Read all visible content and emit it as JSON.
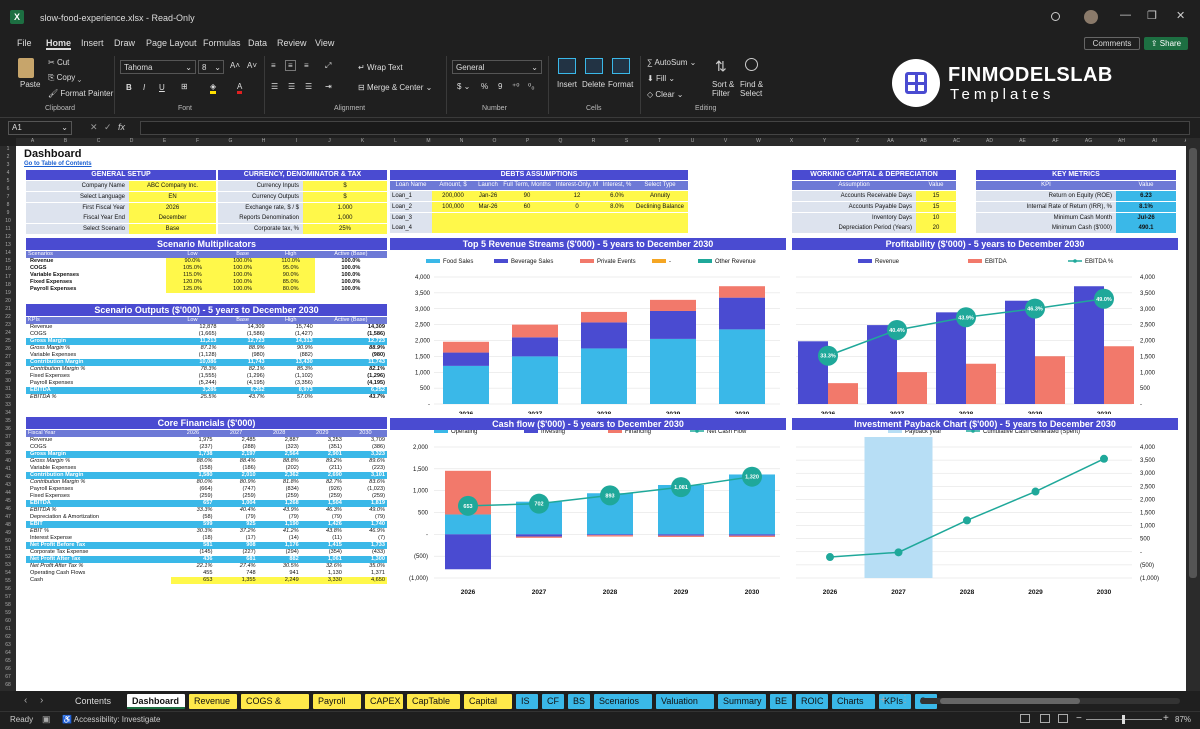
{
  "titlebar": {
    "filename": "slow-food-experience.xlsx",
    "mode": "Read-Only"
  },
  "menu": [
    "File",
    "Home",
    "Insert",
    "Draw",
    "Page Layout",
    "Formulas",
    "Data",
    "Review",
    "View"
  ],
  "menu_active": "Home",
  "comments_label": "Comments",
  "share_label": "Share",
  "ribbon": {
    "paste": "Paste",
    "cut": "Cut",
    "copy": "Copy",
    "format_painter": "Format Painter",
    "clipboard": "Clipboard",
    "font_name": "Tahoma",
    "font_size": "8",
    "font": "Font",
    "wrap": "Wrap Text",
    "merge": "Merge & Center",
    "alignment": "Alignment",
    "numfmt": "General",
    "number": "Number",
    "insert": "Insert",
    "delete": "Delete",
    "format": "Format",
    "cells": "Cells",
    "autosum": "AutoSum",
    "fill": "Fill",
    "clear": "Clear",
    "sort": "Sort & Filter",
    "find": "Find & Select",
    "editing": "Editing",
    "brand1": "FINMODELSLAB",
    "brand2": "Templates"
  },
  "namebox": "A1",
  "fx": "fx",
  "sheet": {
    "title": "Dashboard",
    "toc": "Go to Table of Contents"
  },
  "general": {
    "title": "GENERAL SETUP",
    "rows": [
      [
        "Company Name",
        "ABC Company Inc."
      ],
      [
        "Select Language",
        "EN"
      ],
      [
        "First Fiscal Year",
        "2026"
      ],
      [
        "Fiscal Year End",
        "December"
      ],
      [
        "Select Scenario",
        "Base"
      ]
    ]
  },
  "currency": {
    "title": "CURRENCY, DENOMINATOR & TAX",
    "rows": [
      [
        "Currency Inputs",
        "$"
      ],
      [
        "Currency Outputs",
        "$"
      ],
      [
        "Exchange rate, $ / $",
        "1.000"
      ],
      [
        "Reports Denomination",
        "1,000"
      ],
      [
        "Corporate tax, %",
        "25%"
      ]
    ]
  },
  "debts": {
    "title": "DEBTS ASSUMPTIONS",
    "cols": [
      "Loan Name",
      "Amount, $",
      "Launch",
      "Full Term, Months",
      "Interest-Only, M",
      "Interest, %",
      "Select Type"
    ],
    "rows": [
      [
        "Loan_1",
        "200,000",
        "Jan-26",
        "90",
        "12",
        "6.0%",
        "Annuity"
      ],
      [
        "Loan_2",
        "100,000",
        "Mar-26",
        "60",
        "0",
        "8.0%",
        "Declining Balance"
      ],
      [
        "Loan_3",
        "",
        "",
        "",
        "",
        "",
        ""
      ],
      [
        "Loan_4",
        "",
        "",
        "",
        "",
        "",
        ""
      ]
    ]
  },
  "wc": {
    "title": "WORKING CAPITAL & DEPRECIATION",
    "cols": [
      "Assumption",
      "Value"
    ],
    "rows": [
      [
        "Accounts Receivable Days",
        "15"
      ],
      [
        "Accounts Payable Days",
        "15"
      ],
      [
        "Inventory Days",
        "10"
      ],
      [
        "Depreciation Period (Years)",
        "20"
      ]
    ]
  },
  "kpi": {
    "title": "KEY METRICS",
    "cols": [
      "KPI",
      "Value"
    ],
    "rows": [
      [
        "Return on Equity (ROE)",
        "6.23"
      ],
      [
        "Internal Rate of Return (IRR), %",
        "8.1%"
      ],
      [
        "Minimum Cash Month",
        "Jul-26"
      ],
      [
        "Minimum Cash ($'000)",
        "490.1"
      ]
    ]
  },
  "scenmult": {
    "title": "Scenario Multiplicators",
    "cols": [
      "Scenarios",
      "Low",
      "Base",
      "High",
      "Active (Base)"
    ],
    "rows": [
      [
        "Revenue",
        "90.0%",
        "100.0%",
        "110.0%",
        "100.0%"
      ],
      [
        "COGS",
        "105.0%",
        "100.0%",
        "95.0%",
        "100.0%"
      ],
      [
        "Variable Expenses",
        "115.0%",
        "100.0%",
        "90.0%",
        "100.0%"
      ],
      [
        "Fixed Expenses",
        "120.0%",
        "100.0%",
        "85.0%",
        "100.0%"
      ],
      [
        "Payroll Expenses",
        "125.0%",
        "100.0%",
        "80.0%",
        "100.0%"
      ]
    ]
  },
  "scenout": {
    "title": "Scenario Outputs ($'000) - 5 years to December 2030",
    "cols": [
      "KPIs",
      "Low",
      "Base",
      "High",
      "Active (Base)"
    ],
    "rows": [
      [
        "Revenue",
        "12,878",
        "14,309",
        "15,740",
        "14,309",
        ""
      ],
      [
        "COGS",
        "(1,665)",
        "(1,586)",
        "(1,427)",
        "(1,586)",
        ""
      ],
      [
        "Gross Margin",
        "11,213",
        "12,723",
        "14,313",
        "12,723",
        "hl"
      ],
      [
        "Gross Margin %",
        "87.1%",
        "88.9%",
        "90.9%",
        "88.9%",
        "it"
      ],
      [
        "Variable Expenses",
        "(1,128)",
        "(980)",
        "(882)",
        "(980)",
        ""
      ],
      [
        "Contribution Margin",
        "10,086",
        "11,743",
        "13,430",
        "11,743",
        "hl"
      ],
      [
        "Contribution Margin %",
        "78.3%",
        "82.1%",
        "85.3%",
        "82.1%",
        "it"
      ],
      [
        "Fixed Expenses",
        "(1,555)",
        "(1,296)",
        "(1,102)",
        "(1,296)",
        ""
      ],
      [
        "Payroll Expenses",
        "(5,244)",
        "(4,195)",
        "(3,356)",
        "(4,195)",
        ""
      ],
      [
        "EBITDA",
        "3,286",
        "6,252",
        "8,973",
        "6,252",
        "hl"
      ],
      [
        "EBITDA %",
        "25.5%",
        "43.7%",
        "57.0%",
        "43.7%",
        "it"
      ]
    ]
  },
  "corefin": {
    "title": "Core Financials ($'000)",
    "cols": [
      "Fiscal Year",
      "2026",
      "2027",
      "2028",
      "2029",
      "2030"
    ],
    "rows": [
      [
        "Revenue",
        "1,975",
        "2,485",
        "2,887",
        "3,253",
        "3,709",
        ""
      ],
      [
        "COGS",
        "(237)",
        "(288)",
        "(323)",
        "(351)",
        "(386)",
        ""
      ],
      [
        "Gross Margin",
        "1,738",
        "2,197",
        "2,564",
        "2,901",
        "3,323",
        "hl"
      ],
      [
        "Gross Margin %",
        "88.0%",
        "88.4%",
        "88.8%",
        "89.2%",
        "89.6%",
        "it"
      ],
      [
        "Variable Expenses",
        "(158)",
        "(186)",
        "(202)",
        "(211)",
        "(223)",
        ""
      ],
      [
        "Contribution Margin",
        "1,580",
        "2,010",
        "2,362",
        "2,690",
        "3,101",
        "hl"
      ],
      [
        "Contribution Margin %",
        "80.0%",
        "80.9%",
        "81.8%",
        "82.7%",
        "83.6%",
        "it"
      ],
      [
        "Payroll Expenses",
        "(664)",
        "(747)",
        "(834)",
        "(926)",
        "(1,023)",
        ""
      ],
      [
        "Fixed Expenses",
        "(259)",
        "(259)",
        "(259)",
        "(259)",
        "(259)",
        ""
      ],
      [
        "EBITDA",
        "657",
        "1,004",
        "1,268",
        "1,504",
        "1,819",
        "hl"
      ],
      [
        "EBITDA %",
        "33.3%",
        "40.4%",
        "43.9%",
        "46.3%",
        "49.0%",
        "it"
      ],
      [
        "Depreciation & Amortization",
        "(58)",
        "(79)",
        "(79)",
        "(79)",
        "(79)",
        ""
      ],
      [
        "EBIT",
        "599",
        "925",
        "1,190",
        "1,426",
        "1,740",
        "hl"
      ],
      [
        "EBIT %",
        "30.3%",
        "37.2%",
        "41.2%",
        "43.8%",
        "46.9%",
        "it"
      ],
      [
        "Interest Expense",
        "(18)",
        "(17)",
        "(14)",
        "(11)",
        "(7)",
        ""
      ],
      [
        "Net Profit Before Tax",
        "581",
        "908",
        "1,176",
        "1,415",
        "1,733",
        "hl"
      ],
      [
        "Corporate Tax Expense",
        "(145)",
        "(227)",
        "(294)",
        "(354)",
        "(433)",
        ""
      ],
      [
        "Net Profit After Tax",
        "436",
        "681",
        "882",
        "1,061",
        "1,300",
        "hl"
      ],
      [
        "Net Profit After Tax %",
        "22.1%",
        "27.4%",
        "30.5%",
        "32.6%",
        "35.0%",
        "it"
      ],
      [
        "Operating Cash Flows",
        "455",
        "748",
        "941",
        "1,130",
        "1,371",
        ""
      ],
      [
        "Cash",
        "653",
        "1,355",
        "2,249",
        "3,330",
        "4,650",
        "yl"
      ]
    ]
  },
  "chart_data": [
    {
      "type": "bar",
      "title": "Top 5 Revenue Streams ($'000) - 5 years to December 2030",
      "categories": [
        "2026",
        "2027",
        "2028",
        "2029",
        "2030"
      ],
      "series": [
        {
          "name": "Food Sales",
          "values": [
            1200,
            1500,
            1750,
            2050,
            2350
          ],
          "color": "#3ab8e8"
        },
        {
          "name": "Beverage Sales",
          "values": [
            420,
            600,
            820,
            880,
            1000
          ],
          "color": "#4a4bd1"
        },
        {
          "name": "Private Events",
          "values": [
            340,
            400,
            330,
            350,
            360
          ],
          "color": "#f2796b"
        },
        {
          "name": "-",
          "values": [
            0,
            0,
            0,
            0,
            0
          ],
          "color": "#f5a623"
        },
        {
          "name": "Other Revenue",
          "values": [
            0,
            0,
            0,
            0,
            0
          ],
          "color": "#1fa89a"
        }
      ],
      "yticks": [
        "-",
        "500",
        "1,000",
        "1,500",
        "2,000",
        "2,500",
        "3,000",
        "3,500",
        "4,000"
      ],
      "ylim": [
        0,
        4000
      ]
    },
    {
      "type": "bar",
      "title": "Profitability ($'000) - 5 years to December 2030",
      "categories": [
        "2026",
        "2027",
        "2028",
        "2029",
        "2030"
      ],
      "series": [
        {
          "name": "Revenue",
          "values": [
            1975,
            2485,
            2887,
            3253,
            3709
          ],
          "color": "#4a4bd1"
        },
        {
          "name": "EBITDA",
          "values": [
            657,
            1004,
            1268,
            1504,
            1819
          ],
          "color": "#f2796b"
        },
        {
          "name": "EBITDA %",
          "values": [
            33.3,
            40.4,
            43.9,
            46.3,
            49.0
          ],
          "labels": [
            "33.3%",
            "40.4%",
            "43.9%",
            "46.3%",
            "49.0%"
          ],
          "color": "#1fa89a"
        }
      ],
      "yticks": [
        "-",
        "500",
        "1,000",
        "1,500",
        "2,000",
        "2,500",
        "3,000",
        "3,500",
        "4,000"
      ],
      "ylim": [
        0,
        4000
      ]
    },
    {
      "type": "bar",
      "title": "Cash flow ($'000) - 5 years to December 2030",
      "categories": [
        "2026",
        "2027",
        "2028",
        "2029",
        "2030"
      ],
      "series": [
        {
          "name": "Operating",
          "values": [
            455,
            748,
            941,
            1130,
            1371
          ],
          "color": "#3ab8e8"
        },
        {
          "name": "Investing",
          "values": [
            -800,
            -50,
            -20,
            -30,
            -30
          ],
          "color": "#4a4bd1"
        },
        {
          "name": "Financing",
          "values": [
            1000,
            -30,
            -30,
            -30,
            -30
          ],
          "color": "#f2796b"
        },
        {
          "name": "Net Cash Flow",
          "values": [
            653,
            702,
            893,
            1081,
            1320
          ],
          "labels": [
            "653",
            "702",
            "893",
            "1,081",
            "1,320"
          ],
          "color": "#1fa89a"
        }
      ],
      "yticks": [
        "(1,000)",
        "(500)",
        "-",
        "500",
        "1,000",
        "1,500",
        "2,000"
      ],
      "ylim": [
        -1000,
        2000
      ]
    },
    {
      "type": "line",
      "title": "Investment Payback Chart ($'000) - 5 years to December 2030",
      "categories": [
        "2026",
        "2027",
        "2028",
        "2029",
        "2030"
      ],
      "series": [
        {
          "name": "Payback year",
          "highlight": "2027",
          "color": "#b7def5"
        },
        {
          "name": "Cumulative Cash Generated (Spent)",
          "values": [
            -200,
            -20,
            1200,
            2300,
            3550
          ],
          "color": "#1fa89a"
        }
      ],
      "yticks": [
        "(1,000)",
        "(500)",
        "-",
        "500",
        "1,000",
        "1,500",
        "2,000",
        "2,500",
        "3,000",
        "3,500",
        "4,000"
      ],
      "ylim": [
        -1000,
        4000
      ]
    }
  ],
  "tabs": [
    [
      "Contents",
      "#1f1f1f",
      "#ddd"
    ],
    [
      "Dashboard",
      "#ffffff",
      "#111"
    ],
    [
      "Revenue",
      "#ffe94a",
      "#111"
    ],
    [
      "COGS & OPEX",
      "#ffe94a",
      "#111"
    ],
    [
      "Payroll",
      "#ffe94a",
      "#111"
    ],
    [
      "CAPEX",
      "#ffe94a",
      "#111"
    ],
    [
      "CapTable",
      "#ffe94a",
      "#111"
    ],
    [
      "Capital",
      "#ffe94a",
      "#111"
    ],
    [
      "IS",
      "#3ab8e8",
      "#111"
    ],
    [
      "CF",
      "#3ab8e8",
      "#111"
    ],
    [
      "BS",
      "#3ab8e8",
      "#111"
    ],
    [
      "Scenarios",
      "#3ab8e8",
      "#111"
    ],
    [
      "Valuation",
      "#3ab8e8",
      "#111"
    ],
    [
      "Summary",
      "#3ab8e8",
      "#111"
    ],
    [
      "BE",
      "#3ab8e8",
      "#111"
    ],
    [
      "ROIC",
      "#3ab8e8",
      "#111"
    ],
    [
      "Charts",
      "#3ab8e8",
      "#111"
    ],
    [
      "KPIs",
      "#3ab8e8",
      "#111"
    ],
    [
      "Se",
      "#3ab8e8",
      "#111"
    ]
  ],
  "status": {
    "ready": "Ready",
    "accessibility": "Accessibility: Investigate",
    "zoom": "87%"
  }
}
